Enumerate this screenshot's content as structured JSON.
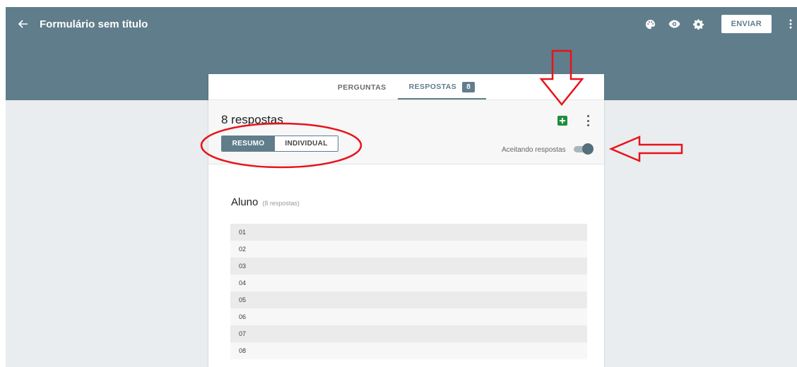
{
  "header": {
    "title": "Formulário sem título",
    "send_label": "ENVIAR",
    "background": "#607d8b"
  },
  "tabs": [
    {
      "label": "PERGUNTAS"
    },
    {
      "label": "RESPOSTAS",
      "badge": "8",
      "active": true
    }
  ],
  "responses": {
    "title": "8 respostas",
    "view_toggle": {
      "summary": "RESUMO",
      "individual": "INDIVIDUAL",
      "selected": "RESUMO"
    },
    "accepting_label": "Aceitando respostas",
    "accepting": true
  },
  "question": {
    "title": "Aluno",
    "count": "(8 respostas)",
    "answers": [
      "01",
      "02",
      "03",
      "04",
      "05",
      "06",
      "07",
      "08"
    ]
  },
  "colors": {
    "accent": "#607d8b",
    "sheets_green": "#1e8e3e",
    "annotation_red": "#e8131a"
  },
  "icons": [
    "arrow-back-icon",
    "palette-icon",
    "eye-icon",
    "gear-icon",
    "more-vert-icon",
    "sheets-icon"
  ]
}
